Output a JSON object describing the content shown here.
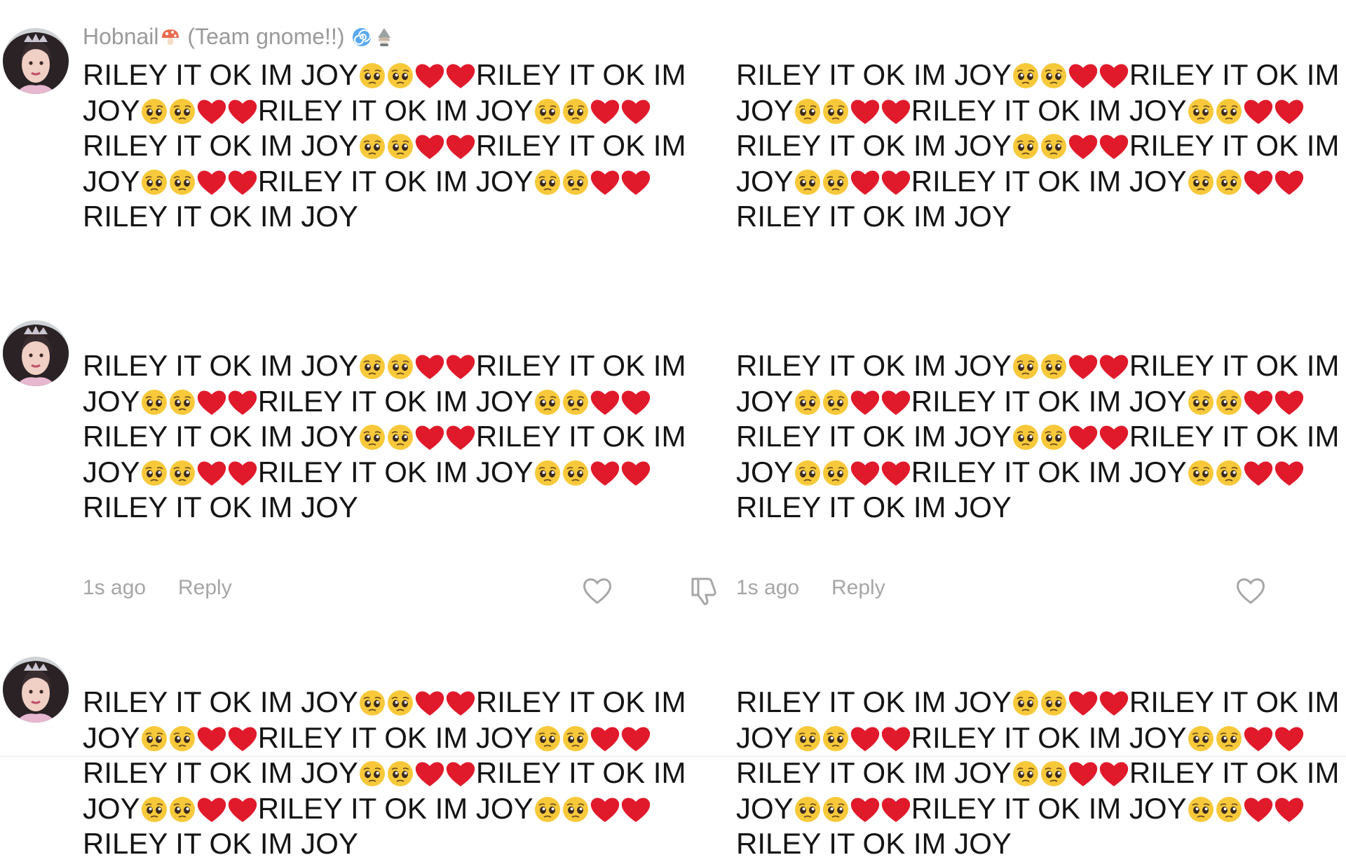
{
  "comment_author": {
    "name": "Hobnail",
    "team_tag": "(Team gnome!!)"
  },
  "comment_text": "RILEY IT OK IM JOY🥺🥺❤️❤️RILEY IT OK IM JOY🥺🥺❤️❤️RILEY IT OK IM JOY🥺🥺❤️❤️RILEY IT OK IM JOY🥺🥺❤️❤️RILEY IT OK IM JOY🥺🥺❤️❤️RILEY IT OK IM JOY🥺🥺❤️❤️RILEY IT OK IM JOY",
  "columns": [
    {
      "comments": [
        {
          "text": "RILEY IT OK IM JOY🥺🥺❤️❤️RILEY IT OK IM JOY🥺🥺❤️❤️RILEY IT OK IM JOY🥺🥺❤️❤️RILEY IT OK IM JOY🥺🥺❤️❤️RILEY IT OK IM JOY🥺🥺❤️❤️RILEY IT OK IM JOY🥺🥺❤️❤️RILEY IT OK IM JOY"
        },
        {
          "text": "RILEY IT OK IM JOY🥺🥺❤️❤️RILEY IT OK IM JOY🥺🥺❤️❤️RILEY IT OK IM JOY🥺🥺❤️❤️RILEY IT OK IM JOY🥺🥺❤️❤️RILEY IT OK IM JOY🥺🥺❤️❤️RILEY IT OK IM JOY🥺🥺❤️❤️RILEY IT OK IM JOY",
          "time": "1s ago",
          "reply_label": "Reply"
        },
        {
          "text": "RILEY IT OK IM JOY🥺🥺❤️❤️RILEY IT OK IM JOY🥺🥺❤️❤️RILEY IT OK IM JOY🥺🥺❤️❤️RILEY IT OK IM JOY🥺🥺❤️❤️RILEY IT OK IM JOY🥺🥺❤️❤️RILEY IT OK IM JOY🥺🥺❤️❤️RILEY IT OK IM JOY"
        }
      ]
    },
    {
      "comments": [
        {
          "text": "RILEY IT OK IM JOY🥺🥺❤️❤️RILEY IT OK IM JOY🥺🥺❤️❤️RILEY IT OK IM JOY🥺🥺❤️❤️RILEY IT OK IM JOY🥺🥺❤️❤️RILEY IT OK IM JOY🥺🥺❤️❤️RILEY IT OK IM JOY🥺🥺❤️❤️RILEY IT OK IM JOY"
        },
        {
          "text": "RILEY IT OK IM JOY🥺🥺❤️❤️RILEY IT OK IM JOY🥺🥺❤️❤️RILEY IT OK IM JOY🥺🥺❤️❤️RILEY IT OK IM JOY🥺🥺❤️❤️RILEY IT OK IM JOY🥺🥺❤️❤️RILEY IT OK IM JOY🥺🥺❤️❤️RILEY IT OK IM JOY",
          "time": "1s ago",
          "reply_label": "Reply"
        },
        {
          "text": "RILEY IT OK IM JOY🥺🥺❤️❤️RILEY IT OK IM JOY🥺🥺❤️❤️RILEY IT OK IM JOY🥺🥺❤️❤️RILEY IT OK IM JOY🥺🥺❤️❤️RILEY IT OK IM JOY🥺🥺❤️❤️RILEY IT OK IM JOY🥺🥺❤️❤️RILEY IT OK IM JOY"
        }
      ]
    }
  ],
  "icons": {
    "username_badges": [
      "mushroom-icon"
    ],
    "team_badges": [
      "spiral-icon",
      "gnome-icon"
    ],
    "like": "heart-outline-icon",
    "dislike": "thumbs-down-outline-icon"
  },
  "colors": {
    "text": "#141414",
    "username": "#9a9a9a",
    "meta": "#a6a6a6",
    "heart": "#e01a2b",
    "pleading_face": "#f7c93a"
  }
}
